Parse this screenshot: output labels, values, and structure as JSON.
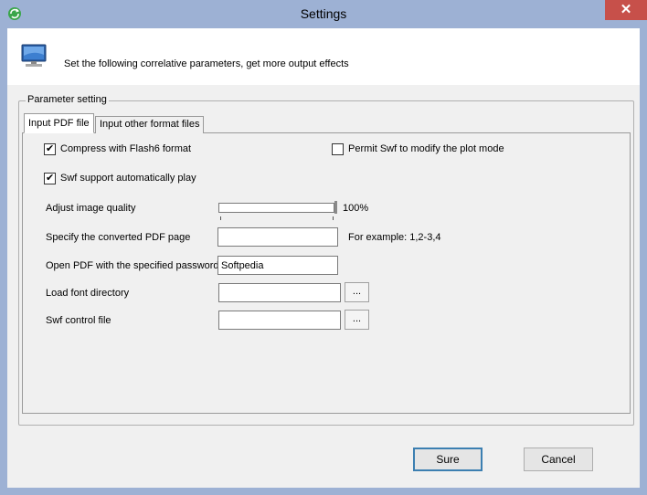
{
  "window": {
    "title": "Settings",
    "close_label": "✕"
  },
  "header": {
    "description": "Set the following correlative parameters, get more output effects"
  },
  "group": {
    "label": "Parameter setting"
  },
  "tabs": [
    {
      "label": "Input PDF file",
      "active": true
    },
    {
      "label": "Input other format files",
      "active": false
    }
  ],
  "options": {
    "compress_flash6": {
      "label": "Compress with Flash6 format",
      "checked": true
    },
    "permit_modify": {
      "label": "Permit Swf to modify the plot mode",
      "checked": false
    },
    "auto_play": {
      "label": "Swf support automatically play",
      "checked": true
    }
  },
  "fields": {
    "image_quality": {
      "label": "Adjust image quality",
      "value_text": "100%",
      "value": 1.0
    },
    "converted_page": {
      "label": "Specify the converted PDF page",
      "value": "",
      "hint": "For example: 1,2-3,4"
    },
    "password": {
      "label": "Open PDF with the specified password",
      "value": "Softpedia"
    },
    "font_dir": {
      "label": "Load font directory",
      "value": "",
      "browse_label": "..."
    },
    "control_file": {
      "label": "Swf control file",
      "value": "",
      "browse_label": "..."
    }
  },
  "buttons": {
    "ok_label": "Sure",
    "cancel_label": "Cancel"
  },
  "colors": {
    "titlebar": "#9db1d4",
    "close": "#c7504a",
    "default_border": "#3c7fb1"
  }
}
